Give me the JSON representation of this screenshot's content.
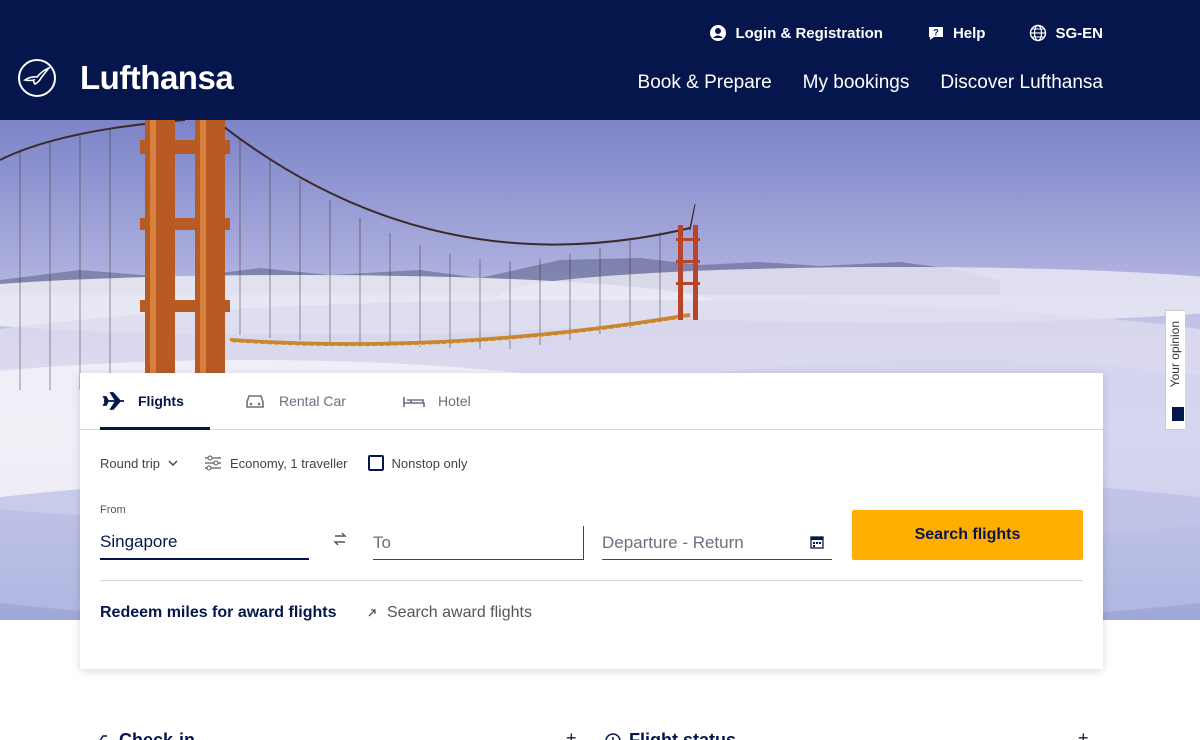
{
  "header": {
    "brand": "Lufthansa",
    "utility": [
      {
        "label": "Login & Registration",
        "icon": "user-icon"
      },
      {
        "label": "Help",
        "icon": "help-icon"
      },
      {
        "label": "SG-EN",
        "icon": "globe-icon"
      }
    ],
    "nav": [
      "Book & Prepare",
      "My bookings",
      "Discover Lufthansa"
    ]
  },
  "side_tab": {
    "label": "Your opinion"
  },
  "booking": {
    "tabs": [
      {
        "label": "Flights",
        "icon": "plane-icon",
        "active": true
      },
      {
        "label": "Rental Car",
        "icon": "car-icon",
        "active": false
      },
      {
        "label": "Hotel",
        "icon": "bed-icon",
        "active": false
      }
    ],
    "trip_type": "Round trip",
    "cabin": "Economy, 1 traveller",
    "nonstop_label": "Nonstop only",
    "nonstop_checked": false,
    "from_label": "From",
    "from_value": "Singapore",
    "to_placeholder": "To",
    "dates_placeholder": "Departure - Return",
    "search_button": "Search flights",
    "redeem_label": "Redeem miles for award flights",
    "award_link": "Search award flights"
  },
  "below": {
    "checkin": "Check-in",
    "flight_status": "Flight status"
  },
  "colors": {
    "navy": "#05164d",
    "accent_yellow": "#ffad00"
  }
}
